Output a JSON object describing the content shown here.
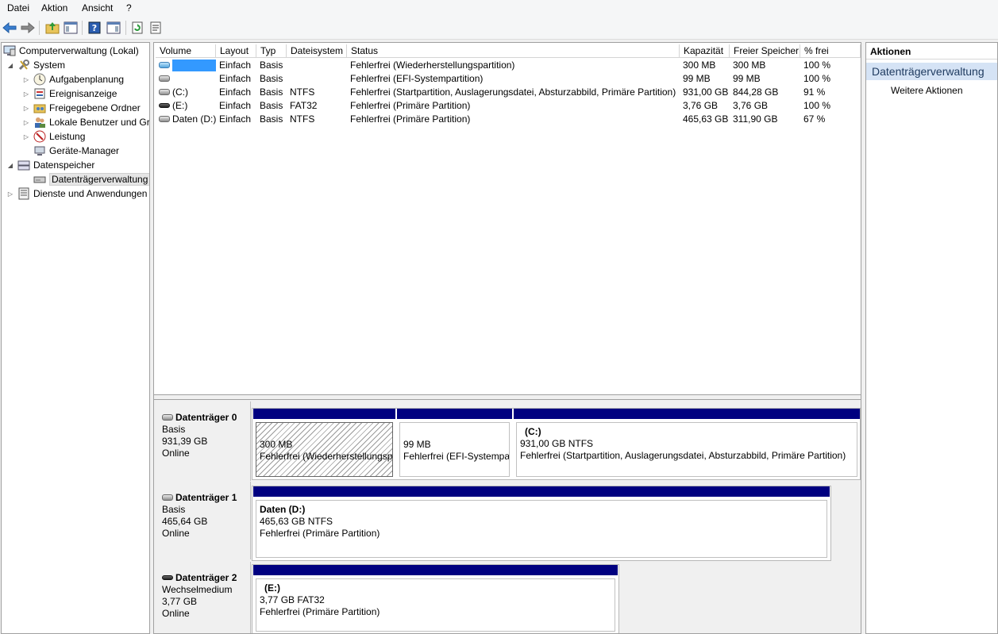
{
  "menu": [
    "Datei",
    "Aktion",
    "Ansicht",
    "?"
  ],
  "toolbar_icons": [
    "back-arrow-icon",
    "forward-arrow-icon",
    "up-folder-icon",
    "show-hide-tree-icon",
    "help-icon",
    "show-hide-action-icon",
    "refresh-icon",
    "properties-icon"
  ],
  "tree": {
    "root": "Computerverwaltung (Lokal)",
    "system": "System",
    "system_children": [
      "Aufgabenplanung",
      "Ereignisanzeige",
      "Freigegebene Ordner",
      "Lokale Benutzer und Gr",
      "Leistung",
      "Geräte-Manager"
    ],
    "storage": "Datenspeicher",
    "storage_child": "Datenträgerverwaltung",
    "services": "Dienste und Anwendungen"
  },
  "volumes": {
    "headers": [
      "Volume",
      "Layout",
      "Typ",
      "Dateisystem",
      "Status",
      "Kapazität",
      "Freier Speicher",
      "% frei"
    ],
    "rows": [
      {
        "volume": "",
        "layout": "Einfach",
        "typ": "Basis",
        "fs": "",
        "status": "Fehlerfrei (Wiederherstellungspartition)",
        "cap": "300 MB",
        "free": "300 MB",
        "pct": "100 %",
        "icon": "blue"
      },
      {
        "volume": "",
        "layout": "Einfach",
        "typ": "Basis",
        "fs": "",
        "status": "Fehlerfrei (EFI-Systempartition)",
        "cap": "99 MB",
        "free": "99 MB",
        "pct": "100 %",
        "icon": "fixed"
      },
      {
        "volume": "(C:)",
        "layout": "Einfach",
        "typ": "Basis",
        "fs": "NTFS",
        "status": "Fehlerfrei (Startpartition, Auslagerungsdatei, Absturzabbild, Primäre Partition)",
        "cap": "931,00 GB",
        "free": "844,28 GB",
        "pct": "91 %",
        "icon": "fixed"
      },
      {
        "volume": "(E:)",
        "layout": "Einfach",
        "typ": "Basis",
        "fs": "FAT32",
        "status": "Fehlerfrei (Primäre Partition)",
        "cap": "3,76 GB",
        "free": "3,76 GB",
        "pct": "100 %",
        "icon": "removable"
      },
      {
        "volume": "Daten (D:)",
        "layout": "Einfach",
        "typ": "Basis",
        "fs": "NTFS",
        "status": "Fehlerfrei (Primäre Partition)",
        "cap": "465,63 GB",
        "free": "311,90 GB",
        "pct": "67 %",
        "icon": "fixed"
      }
    ]
  },
  "disks": [
    {
      "title": "Datenträger 0",
      "type": "Basis",
      "size": "931,39 GB",
      "state": "Online",
      "partitions": [
        {
          "name": "",
          "size": "300 MB",
          "status": "Fehlerfrei (Wiederherstellungsp"
        },
        {
          "name": "",
          "size": "99 MB",
          "status": "Fehlerfrei (EFI-Systempar"
        },
        {
          "name": "(C:)",
          "size": "931,00 GB NTFS",
          "status": "Fehlerfrei (Startpartition, Auslagerungsdatei, Absturzabbild, Primäre Partition)"
        }
      ]
    },
    {
      "title": "Datenträger 1",
      "type": "Basis",
      "size": "465,64 GB",
      "state": "Online",
      "partitions": [
        {
          "name": "Daten  (D:)",
          "size": "465,63 GB NTFS",
          "status": "Fehlerfrei (Primäre Partition)"
        }
      ]
    },
    {
      "title": "Datenträger 2",
      "type": "Wechselmedium",
      "size": "3,77 GB",
      "state": "Online",
      "partitions": [
        {
          "name": "(E:)",
          "size": "3,77 GB FAT32",
          "status": "Fehlerfrei (Primäre Partition)"
        }
      ]
    }
  ],
  "actions": {
    "header": "Aktionen",
    "section": "Datenträgerverwaltung",
    "item": "Weitere Aktionen"
  },
  "colors": {
    "partition_bar": "#000080",
    "selection_blue": "#3399ff",
    "action_section_bg": "#d5e3f5"
  }
}
